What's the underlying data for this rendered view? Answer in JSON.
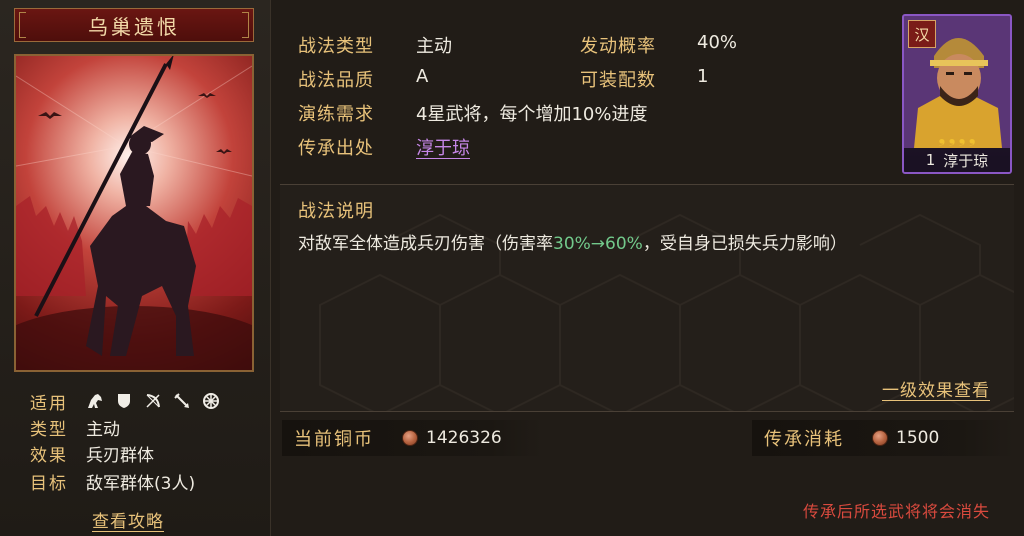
{
  "skill": {
    "name": "乌巢遗恨"
  },
  "attributes": {
    "apply_label": "适用",
    "unit_icons": [
      "cavalry-icon",
      "shield-icon",
      "bow-icon",
      "spear-icon",
      "siege-wheel-icon"
    ],
    "type_label": "类型",
    "type_value": "主动",
    "effect_label": "效果",
    "effect_value": "兵刃群体",
    "target_label": "目标",
    "target_value": "敌军群体(3人)",
    "guide_link": "查看攻略"
  },
  "info": {
    "type_label": "战法类型",
    "type_value": "主动",
    "rate_label": "发动概率",
    "rate_value": "40%",
    "quality_label": "战法品质",
    "quality_value": "A",
    "slots_label": "可装配数",
    "slots_value": "1",
    "requirement_label": "演练需求",
    "requirement_value": "4星武将，每个增加10%进度",
    "source_label": "传承出处",
    "source_value": "淳于琼"
  },
  "general": {
    "faction": "汉",
    "level": "1",
    "name": "淳于琼",
    "stars": 4
  },
  "description": {
    "title": "战法说明",
    "text_before": "对敌军全体造成兵刃伤害（伤害率",
    "text_highlight": "30%→60%",
    "text_after": "，受自身已损失兵力影响）",
    "level_link": "一级效果查看"
  },
  "costs": {
    "coins_label": "当前铜币",
    "coins_value": "1426326",
    "inherit_label": "传承消耗",
    "inherit_value": "1500"
  },
  "warning": "传承后所选武将将会消失",
  "colors": {
    "gold": "#e8c27a",
    "highlight_green": "#72c98b",
    "link_purple": "#c586e6",
    "warning_red": "#d94a3e",
    "title_bar_red": "#6a1612"
  }
}
